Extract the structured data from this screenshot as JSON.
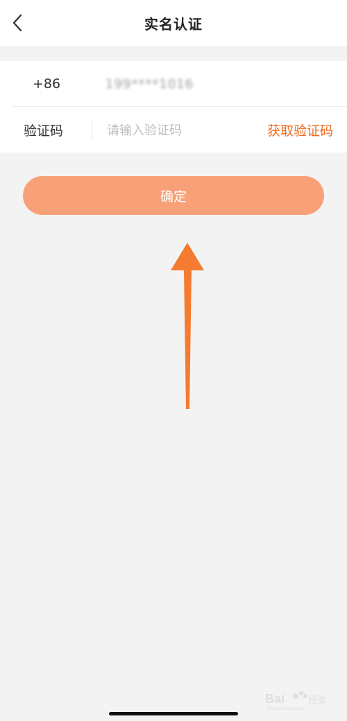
{
  "header": {
    "title": "实名认证",
    "back_icon": "chevron-left-icon"
  },
  "form": {
    "phone": {
      "country_code": "+86",
      "value": "199****1016"
    },
    "code": {
      "label": "验证码",
      "placeholder": "请输入验证码",
      "value": "",
      "get_code_label": "获取验证码"
    }
  },
  "confirm": {
    "label": "确定"
  },
  "annotation": {
    "icon": "arrow-up-icon",
    "color": "#f47b2f"
  },
  "watermark": {
    "text": "Baidu 经验"
  },
  "colors": {
    "accent": "#f06a1d",
    "button_bg": "#f8a178",
    "page_bg": "#f3f3f3"
  }
}
